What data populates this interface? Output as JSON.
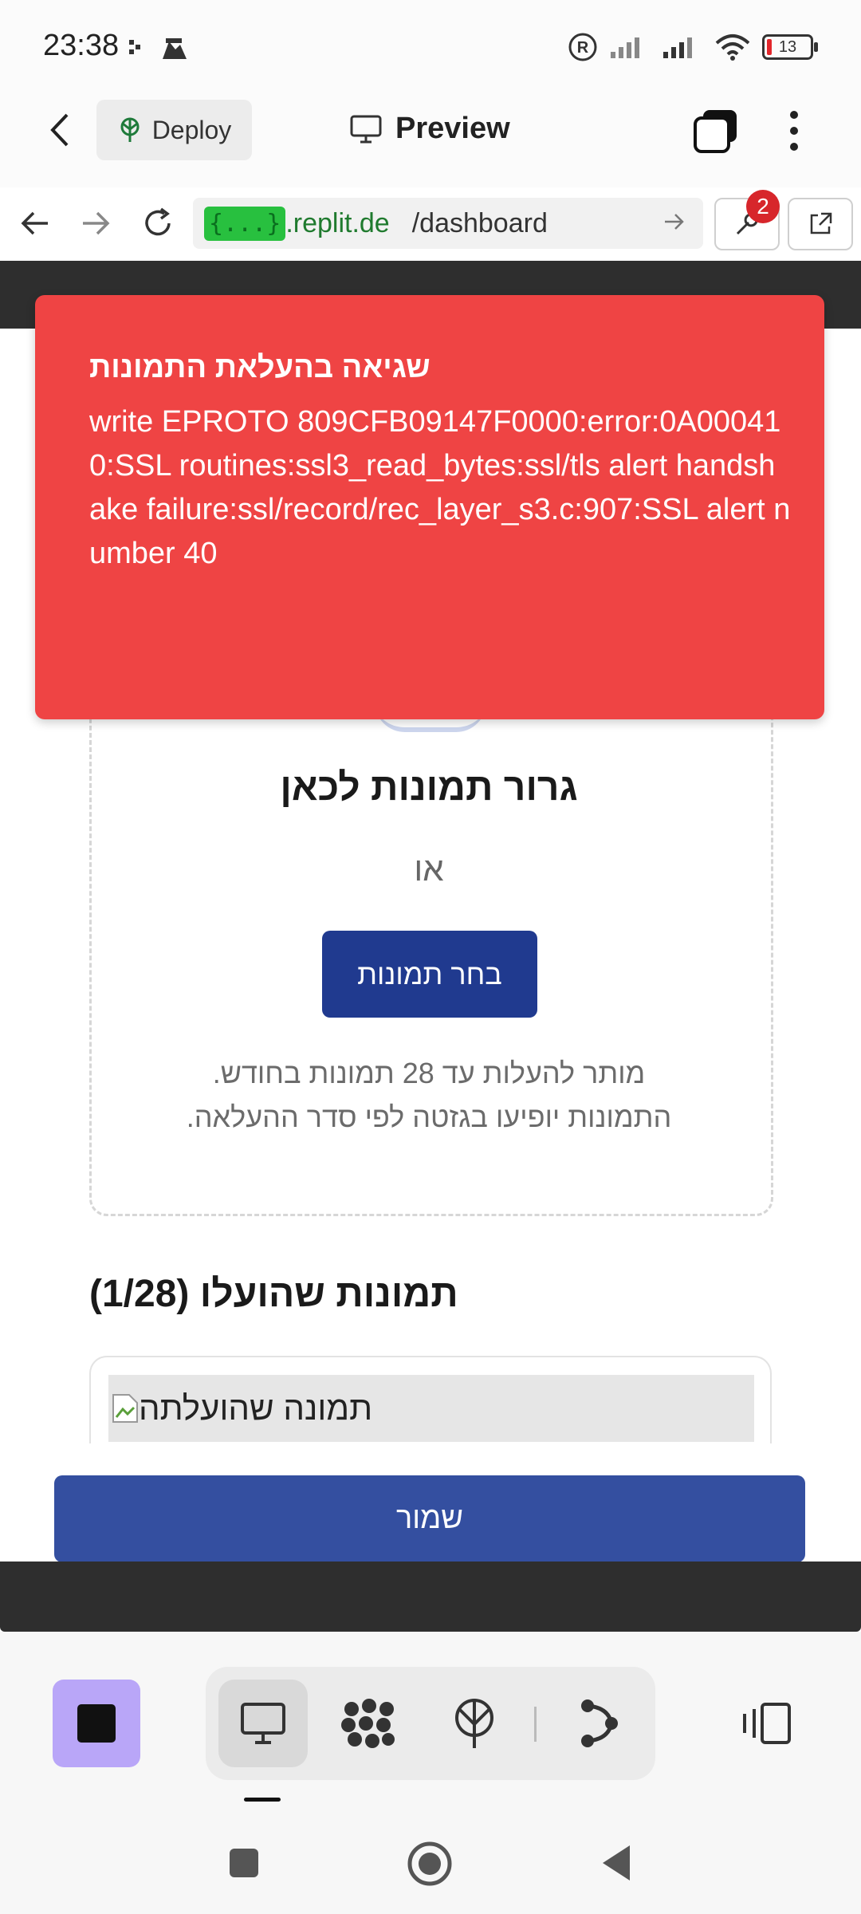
{
  "status": {
    "time": "23:38",
    "battery": "13"
  },
  "header": {
    "deploy_label": "Deploy",
    "preview_label": "Preview"
  },
  "url": {
    "chip": "{...}",
    "domain": ".replit.de",
    "path": "/dashboard",
    "badge_count": "2"
  },
  "toast": {
    "title": "שגיאה בהעלאת התמונות",
    "message": "write EPROTO 809CFB09147F0000:error:0A000410:SSL routines:ssl3_read_bytes:ssl/tls alert handshake failure:ssl/record/rec_layer_s3.c:907:SSL alert number 40"
  },
  "upload": {
    "drop_title": "גרור תמונות לכאן",
    "or_text": "או",
    "choose_button": "בחר תמונות",
    "note_line1": "מותר להעלות עד 28 תמונות בחודש.",
    "note_line2": "התמונות יופיעו בגזטה לפי סדר ההעלאה."
  },
  "uploaded": {
    "heading": "תמונות שהועלו (1/28)",
    "image_alt": "תמונה שהועלתה"
  },
  "save_button": "שמור",
  "colors": {
    "toast": "#ef4444",
    "primary": "#203a8f",
    "save": "#344fa0",
    "stop": "#b9a6f8"
  }
}
